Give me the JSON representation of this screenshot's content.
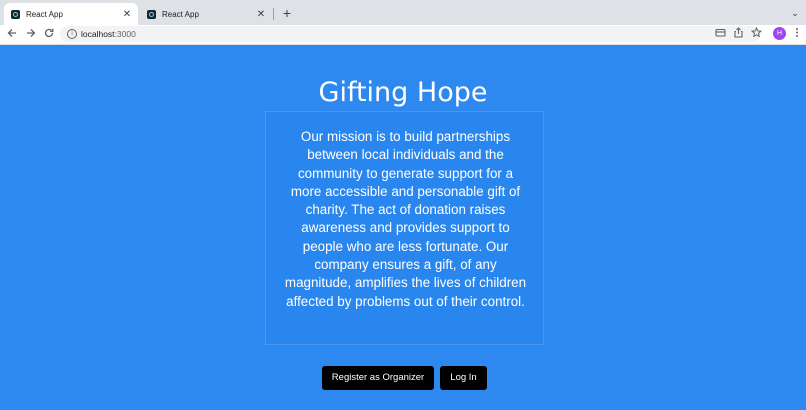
{
  "browser": {
    "tabs": [
      {
        "title": "React App",
        "active": true
      },
      {
        "title": "React App",
        "active": false
      }
    ],
    "close_glyph": "✕",
    "new_tab_glyph": "+",
    "tab_search_glyph": "⌄",
    "url_host": "localhost",
    "url_port": ":3000",
    "profile_initial": "H",
    "icons": [
      "back-icon",
      "forward-icon",
      "reload-icon",
      "info-icon",
      "card-icon",
      "share-icon",
      "bookmark-star-icon",
      "avatar",
      "menu-icon"
    ]
  },
  "page": {
    "title": "Gifting Hope",
    "mission": "Our mission is to build partnerships between local individuals and the community to generate support for a more accessible and personable gift of charity. The act of donation raises awareness and provides support to people who are less fortunate. Our company ensures a gift, of any magnitude, amplifies the lives of children affected by problems out of their control.",
    "buttons": {
      "register": "Register as Organizer",
      "login": "Log In"
    },
    "colors": {
      "background": "#2d88f0",
      "button": "#000000",
      "text": "#ffffff"
    }
  }
}
